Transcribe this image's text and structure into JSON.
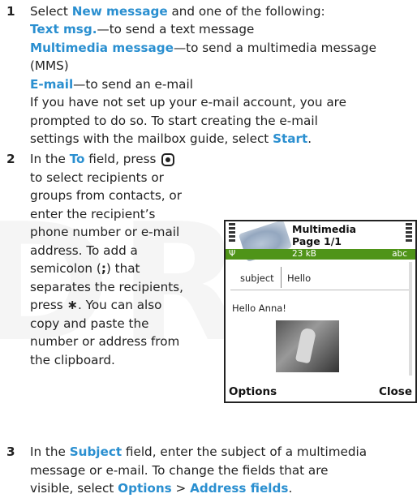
{
  "watermark": "DRAFT",
  "step1": {
    "num": "1",
    "l1_pre": "Select ",
    "l1_kw": "New message",
    "l1_post": " and one of the following:",
    "opt1_kw": "Text msg.",
    "opt1_desc": "—to send a text message",
    "opt2_kw": "Multimedia message",
    "opt2_desc": "—to send a multimedia message",
    "opt2_cont": "(MMS)",
    "opt3_kw": "E-mail",
    "opt3_desc": "—to send an e-mail",
    "para1": "If you have not set up your e-mail account, you are",
    "para2": "prompted to do so. To start creating the e-mail",
    "para3_pre": "settings with the mailbox guide, select ",
    "para3_kw": "Start",
    "para3_post": "."
  },
  "step2": {
    "num": "2",
    "l1_pre": "In the ",
    "l1_kw": "To",
    "l1_post": " field, press",
    "key_icon": "selection-key-icon",
    "lines": [
      "to select recipients or",
      "groups from contacts, or",
      "enter the recipient’s",
      "phone number or e-mail",
      "address. To add a"
    ],
    "semi_pre": "semicolon (",
    "semi_kw": ";",
    "semi_post": ") that",
    "l8": "separates the recipients,",
    "l9_pre": "press ",
    "l9_star": "∗",
    "l9_post": ". You can also",
    "l10": "copy and paste the",
    "l11": "number or address from",
    "l12": "the clipboard."
  },
  "step3": {
    "num": "3",
    "l1_pre": "In the ",
    "l1_kw": "Subject",
    "l1_post": " field, enter the subject of a multimedia",
    "l2": "message or e-mail. To change the fields that are",
    "l3_pre": "visible, select ",
    "l3_kw1": "Options",
    "l3_mid": " > ",
    "l3_kw2": "Address fields",
    "l3_post": "."
  },
  "phone": {
    "title1": "Multimedia",
    "title2": "Page 1/1",
    "size": "23 kB",
    "abc": "abc",
    "subject_label": "subject",
    "subject_value": "Hello",
    "message": "Hello Anna!",
    "softkey_left": "Options",
    "softkey_right": "Close"
  },
  "colors": {
    "keyword": "#2a8fd0",
    "status_band": "#4f9418"
  }
}
